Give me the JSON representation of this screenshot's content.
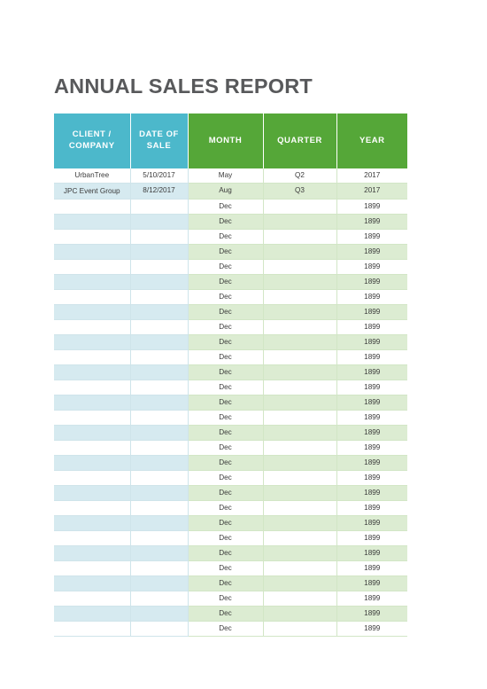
{
  "document": {
    "title": "ANNUAL SALES REPORT"
  },
  "theme": {
    "title_color": "#58595b",
    "header_teal": "#4cb8cb",
    "header_green": "#55a738",
    "row_tint_blue": "#d6eaf0",
    "row_tint_green": "#dcecd2",
    "page_background": "#ffffff",
    "body_text_color": "#3b3b3b",
    "header_text_color": "#ffffff"
  },
  "table": {
    "columns": [
      {
        "key": "client",
        "label": "CLIENT / COMPANY",
        "header_style": "teal"
      },
      {
        "key": "date",
        "label": "DATE OF SALE",
        "header_style": "teal"
      },
      {
        "key": "month",
        "label": "MONTH",
        "header_style": "green"
      },
      {
        "key": "quarter",
        "label": "QUARTER",
        "header_style": "green"
      },
      {
        "key": "year",
        "label": "YEAR",
        "header_style": "green"
      }
    ],
    "rows": [
      {
        "client": "UrbanTree",
        "date": "5/10/2017",
        "month": "May",
        "quarter": "Q2",
        "year": "2017"
      },
      {
        "client": "JPC Event Group",
        "date": "8/12/2017",
        "month": "Aug",
        "quarter": "Q3",
        "year": "2017"
      },
      {
        "client": "",
        "date": "",
        "month": "Dec",
        "quarter": "",
        "year": "1899"
      },
      {
        "client": "",
        "date": "",
        "month": "Dec",
        "quarter": "",
        "year": "1899"
      },
      {
        "client": "",
        "date": "",
        "month": "Dec",
        "quarter": "",
        "year": "1899"
      },
      {
        "client": "",
        "date": "",
        "month": "Dec",
        "quarter": "",
        "year": "1899"
      },
      {
        "client": "",
        "date": "",
        "month": "Dec",
        "quarter": "",
        "year": "1899"
      },
      {
        "client": "",
        "date": "",
        "month": "Dec",
        "quarter": "",
        "year": "1899"
      },
      {
        "client": "",
        "date": "",
        "month": "Dec",
        "quarter": "",
        "year": "1899"
      },
      {
        "client": "",
        "date": "",
        "month": "Dec",
        "quarter": "",
        "year": "1899"
      },
      {
        "client": "",
        "date": "",
        "month": "Dec",
        "quarter": "",
        "year": "1899"
      },
      {
        "client": "",
        "date": "",
        "month": "Dec",
        "quarter": "",
        "year": "1899"
      },
      {
        "client": "",
        "date": "",
        "month": "Dec",
        "quarter": "",
        "year": "1899"
      },
      {
        "client": "",
        "date": "",
        "month": "Dec",
        "quarter": "",
        "year": "1899"
      },
      {
        "client": "",
        "date": "",
        "month": "Dec",
        "quarter": "",
        "year": "1899"
      },
      {
        "client": "",
        "date": "",
        "month": "Dec",
        "quarter": "",
        "year": "1899"
      },
      {
        "client": "",
        "date": "",
        "month": "Dec",
        "quarter": "",
        "year": "1899"
      },
      {
        "client": "",
        "date": "",
        "month": "Dec",
        "quarter": "",
        "year": "1899"
      },
      {
        "client": "",
        "date": "",
        "month": "Dec",
        "quarter": "",
        "year": "1899"
      },
      {
        "client": "",
        "date": "",
        "month": "Dec",
        "quarter": "",
        "year": "1899"
      },
      {
        "client": "",
        "date": "",
        "month": "Dec",
        "quarter": "",
        "year": "1899"
      },
      {
        "client": "",
        "date": "",
        "month": "Dec",
        "quarter": "",
        "year": "1899"
      },
      {
        "client": "",
        "date": "",
        "month": "Dec",
        "quarter": "",
        "year": "1899"
      },
      {
        "client": "",
        "date": "",
        "month": "Dec",
        "quarter": "",
        "year": "1899"
      },
      {
        "client": "",
        "date": "",
        "month": "Dec",
        "quarter": "",
        "year": "1899"
      },
      {
        "client": "",
        "date": "",
        "month": "Dec",
        "quarter": "",
        "year": "1899"
      },
      {
        "client": "",
        "date": "",
        "month": "Dec",
        "quarter": "",
        "year": "1899"
      },
      {
        "client": "",
        "date": "",
        "month": "Dec",
        "quarter": "",
        "year": "1899"
      },
      {
        "client": "",
        "date": "",
        "month": "Dec",
        "quarter": "",
        "year": "1899"
      },
      {
        "client": "",
        "date": "",
        "month": "Dec",
        "quarter": "",
        "year": "1899"
      },
      {
        "client": "",
        "date": "",
        "month": "Dec",
        "quarter": "",
        "year": "1899"
      }
    ]
  }
}
